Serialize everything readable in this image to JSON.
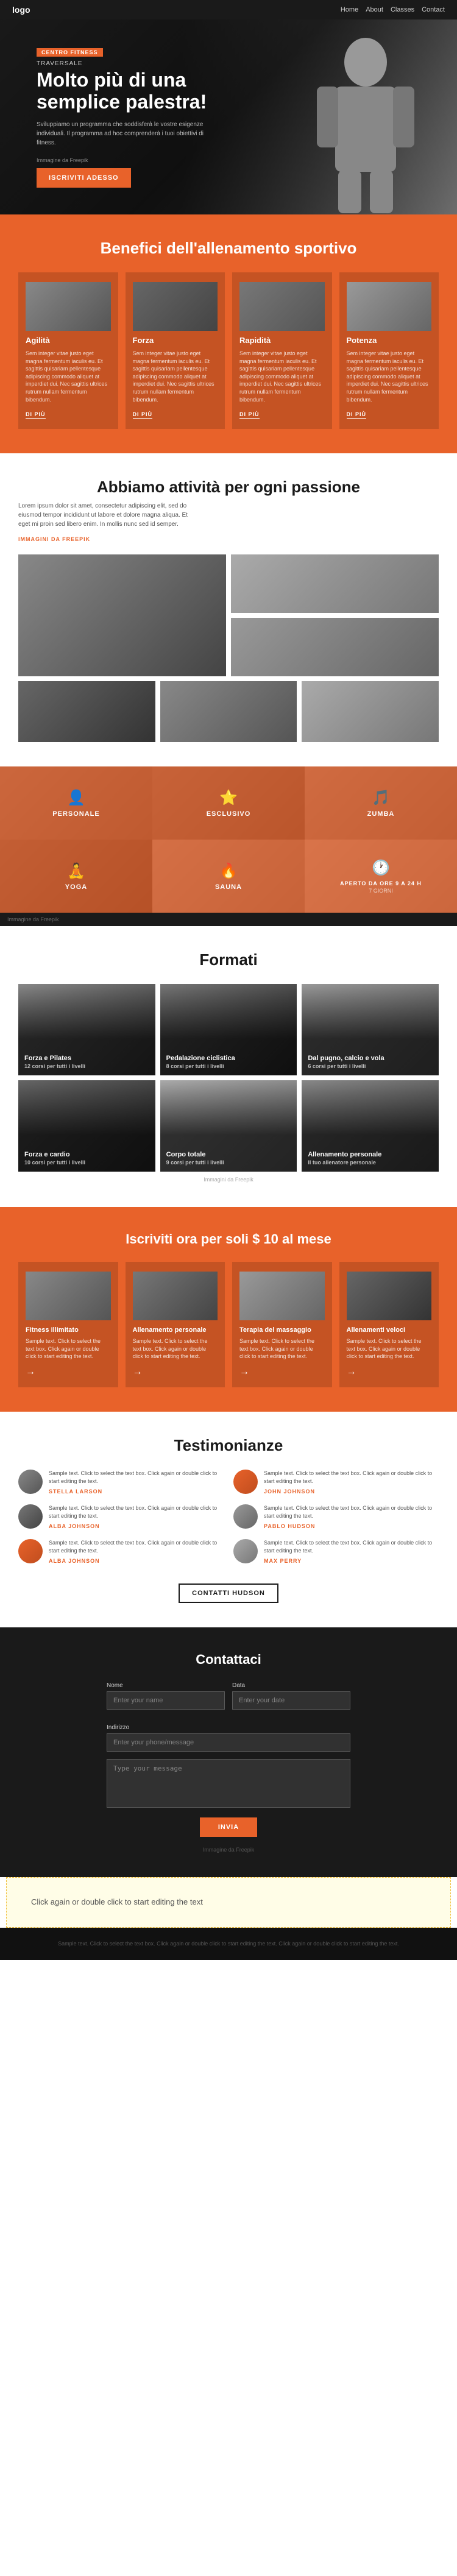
{
  "nav": {
    "logo": "logo",
    "links": [
      "Home",
      "About",
      "Classes",
      "Contact"
    ]
  },
  "hero": {
    "tag": "CENTRO FITNESS",
    "subtitle": "TRAVERSALE",
    "title": "Molto più di una semplice palestra!",
    "description": "Sviluppiamo un programma che soddisferà le vostre esigenze individuali. Il programma ad hoc comprenderà i tuoi obiettivi di fitness.",
    "photo_credit": "Immagine da Freepik",
    "cta": "ISCRIVITI ADESSO"
  },
  "benefits": {
    "title": "Benefici dell'allenamento sportivo",
    "cards": [
      {
        "title": "Agilità",
        "text": "Sem integer vitae justo eget magna fermentum iaculis eu. Et sagittis quisariam pellentesque adipiscing commodo aliquet at imperdiet dui. Nec sagittis ultrices rutrum nullam fermentum bibendum.",
        "link": "DI PIÙ"
      },
      {
        "title": "Forza",
        "text": "Sem integer vitae justo eget magna fermentum iaculis eu. Et sagittis quisariam pellentesque adipiscing commodo aliquet at imperdiet dui. Nec sagittis ultrices rutrum nullam fermentum bibendum.",
        "link": "DI PIÙ"
      },
      {
        "title": "Rapidità",
        "text": "Sem integer vitae justo eget magna fermentum iaculis eu. Et sagittis quisariam pellentesque adipiscing commodo aliquet at imperdiet dui. Nec sagittis ultrices rutrum nullam fermentum bibendum.",
        "link": "DI PIÙ"
      },
      {
        "title": "Potenza",
        "text": "Sem integer vitae justo eget magna fermentum iaculis eu. Et sagittis quisariam pellentesque adipiscing commodo aliquet at imperdiet dui. Nec sagittis ultrices rutrum nullam fermentum bibendum.",
        "link": "DI PIÙ"
      }
    ]
  },
  "passione": {
    "title": "Abbiamo attività per ogni passione",
    "text": "Lorem ipsum dolor sit amet, consectetur adipiscing elit, sed do eiusmod tempor incididunt ut labore et dolore magna aliqua. Et eget mi proin sed libero enim. In mollis nunc sed id semper.",
    "link": "Immagini da Freepik"
  },
  "activities": {
    "items": [
      {
        "label": "PERSONALE",
        "icon": "👤"
      },
      {
        "label": "ESCLUSIVO",
        "icon": "⭐"
      },
      {
        "label": "ZUMBA",
        "icon": "🎵"
      },
      {
        "label": "YOGA",
        "icon": "🧘"
      },
      {
        "label": "SAUNA",
        "icon": "🔥"
      },
      {
        "label": "APERTO DA ORE 9 A 24 H",
        "icon": "🕐",
        "sublabel": "7 GIORNI"
      }
    ],
    "credit": "Immagine da Freepik"
  },
  "formati": {
    "title": "Formati",
    "items": [
      {
        "label": "Forza e Pilates",
        "sublabel": "12 corsi per tutti i livelli"
      },
      {
        "label": "Pedalazione ciclistica",
        "sublabel": "8 corsi per tutti i livelli"
      },
      {
        "label": "Dal pugno, calcio e vola",
        "sublabel": "6 corsi per tutti i livelli"
      },
      {
        "label": "Forza e cardio",
        "sublabel": "10 corsi per tutti i livelli"
      },
      {
        "label": "Corpo totale",
        "sublabel": "9 corsi per tutti i livelli"
      },
      {
        "label": "Allenamento personale",
        "sublabel": "Il tuo allenatore personale"
      }
    ],
    "credit": "Immagini da Freepik"
  },
  "iscriviti": {
    "title": "Iscriviti ora per soli $ 10 al mese",
    "cards": [
      {
        "title": "Fitness illimitato",
        "text": "Sample text. Click to select the text box. Click again or double click to start editing the text."
      },
      {
        "title": "Allenamento personale",
        "text": "Sample text. Click to select the text box. Click again or double click to start editing the text."
      },
      {
        "title": "Terapia del massaggio",
        "text": "Sample text. Click to select the text box. Click again or double click to start editing the text."
      },
      {
        "title": "Allenamenti veloci",
        "text": "Sample text. Click to select the text box. Click again or double click to start editing the text."
      }
    ]
  },
  "testimonianze": {
    "title": "Testimonianze",
    "items": [
      {
        "text": "Sample text. Click to select the text box. Click again or double click to start editing the text.",
        "name": "STELLA LARSON",
        "avatar_class": "t1"
      },
      {
        "text": "Sample text. Click to select the text box. Click again or double click to start editing the text.",
        "name": "JOHN JOHNSON",
        "avatar_class": "t2"
      },
      {
        "text": "Sample text. Click to select the text box. Click again or double click to start editing the text.",
        "name": "ALBA JOHNSON",
        "avatar_class": "t3"
      },
      {
        "text": "Sample text. Click to select the text box. Click again or double click to start editing the text.",
        "name": "PABLO HUDSON",
        "avatar_class": "t4"
      },
      {
        "text": "Sample text. Click to select the text box. Click again or double click to start editing the text.",
        "name": "ALBA JOHNSON",
        "avatar_class": "t5"
      },
      {
        "text": "Sample text. Click to select the text box. Click again or double click to start editing the text.",
        "name": "MAX PERRY",
        "avatar_class": "t6"
      }
    ],
    "cta": "CONTATTI HUDSON"
  },
  "contatti": {
    "title": "Contattaci",
    "form": {
      "name_label": "Nome",
      "name_placeholder": "Enter your name",
      "date_label": "Data",
      "date_placeholder": "Enter your date",
      "phone_label": "Indirizzo",
      "phone_placeholder": "Enter your phone/message",
      "message_label": "",
      "message_placeholder": "Type your message",
      "submit": "INVIA"
    },
    "credit": "Immagine da Freepik"
  },
  "edit_hint": {
    "text": "Click again or double click to start editing the text"
  },
  "footer": {
    "text": "Sample text. Click to select the text box. Click again or double click to start editing the text. Click again or double click to start editing the text."
  },
  "colors": {
    "orange": "#e8622a",
    "dark": "#1a1a1a",
    "light": "#ffffff"
  }
}
